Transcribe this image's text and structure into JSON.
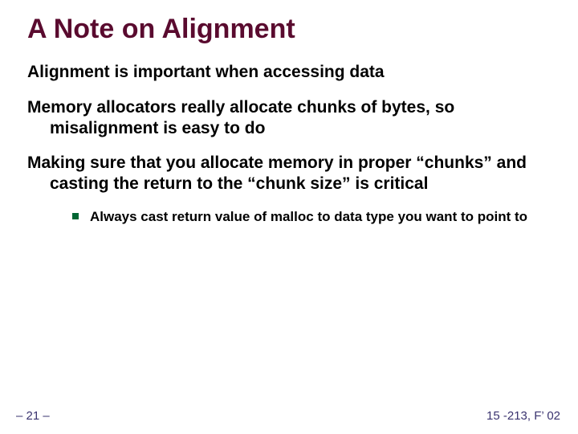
{
  "title": "A Note on Alignment",
  "paragraphs": {
    "p1": "Alignment is important when accessing data",
    "p2": "Memory allocators really allocate chunks of bytes, so misalignment is easy to do",
    "p3": "Making sure that you allocate memory in proper “chunks” and casting the return to the “chunk size” is critical"
  },
  "bullets": {
    "b1": "Always cast return value of malloc to data type you want to point to"
  },
  "footer": {
    "left": "– 21 –",
    "right": "15 -213, F’ 02"
  }
}
